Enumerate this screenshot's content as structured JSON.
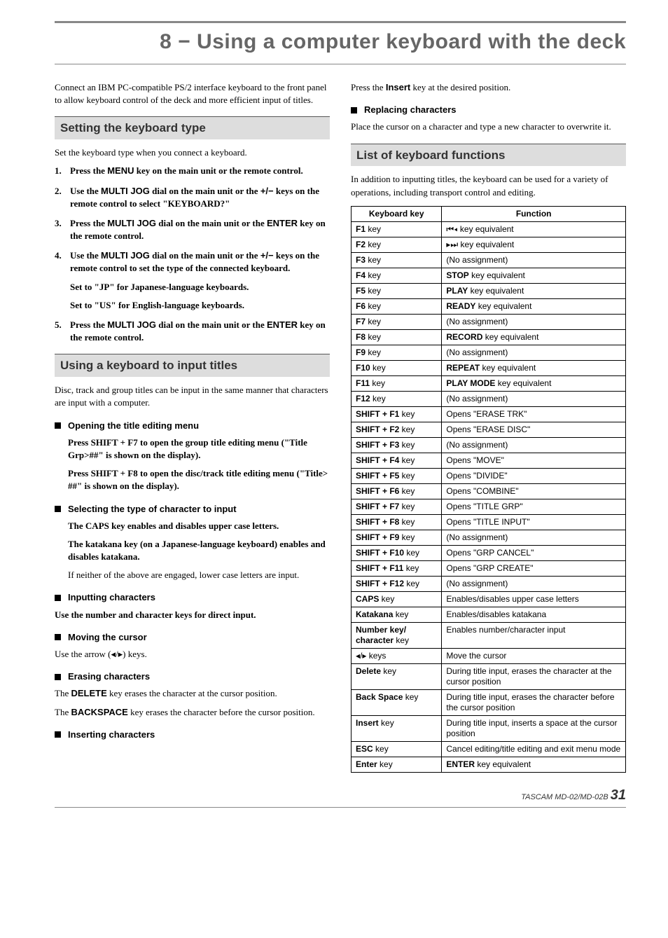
{
  "chapter": {
    "title": "8 − Using a computer keyboard with the deck"
  },
  "intro_left": "Connect an IBM PC-compatible PS/2 interface keyboard to the front panel to allow keyboard control of the deck and more efficient input of titles.",
  "section_setting": {
    "title": "Setting the keyboard type",
    "intro": "Set the keyboard type when you connect a keyboard.",
    "steps": [
      {
        "num": "1.",
        "text_parts": [
          "Press the ",
          "MENU",
          " key on the main unit or the remote control."
        ]
      },
      {
        "num": "2.",
        "text_parts": [
          "Use the ",
          "MULTI JOG",
          " dial on the main unit or the ",
          "+/−",
          " keys on the remote control to select \"KEYBOARD?\""
        ]
      },
      {
        "num": "3.",
        "text_parts": [
          "Press the ",
          "MULTI JOG",
          " dial on the main unit or the ",
          "ENTER",
          " key on the remote control."
        ]
      },
      {
        "num": "4.",
        "text_parts": [
          "Use the ",
          "MULTI JOG",
          " dial on the main unit or the ",
          "+/−",
          " keys on the remote control to set the type of the connected keyboard."
        ],
        "sub": [
          "Set to \"JP\" for Japanese-language keyboards.",
          "Set to \"US\" for English-language keyboards."
        ]
      },
      {
        "num": "5.",
        "text_parts": [
          "Press  the ",
          "MULTI JOG",
          " dial on the main unit or the ",
          "ENTER",
          " key on the remote control."
        ]
      }
    ]
  },
  "section_using": {
    "title": "Using a keyboard to input titles",
    "intro": "Disc, track and group titles can be input in the same manner that characters are input with a computer.",
    "opening": {
      "title": "Opening the title editing menu",
      "p1": "Press SHIFT + F7 to open the group title editing menu (\"Title Grp>##\" is shown on the display).",
      "p2": "Press SHIFT + F8 to open the disc/track title editing menu (\"Title> ##\" is shown on the display)."
    },
    "selecting": {
      "title": "Selecting the type of character to input",
      "p1": "The CAPS key enables and disables upper case letters.",
      "p2": "The katakana key (on a Japanese-language keyboard) enables and disables katakana.",
      "p3": "If neither of the above are engaged, lower case letters are input."
    },
    "inputting": {
      "title": "Inputting characters",
      "p": "Use the number and character keys for direct input."
    },
    "moving": {
      "title": "Moving the cursor",
      "p": "Use the arrow (◂/▸) keys."
    },
    "erasing": {
      "title": "Erasing characters",
      "p1_pre": "The ",
      "p1_key": "DELETE",
      "p1_post": " key erases the character at the cursor position.",
      "p2_pre": "The ",
      "p2_key": "BACKSPACE",
      "p2_post": " key erases the character before the cursor position."
    },
    "inserting_h": "Inserting characters"
  },
  "right": {
    "press_insert_pre": "Press the ",
    "press_insert_key": "Insert",
    "press_insert_post": " key at the desired position.",
    "replacing": {
      "title": "Replacing characters",
      "p": "Place the cursor on a character and type a new character to overwrite it."
    }
  },
  "section_list": {
    "title": "List of keyboard functions",
    "intro": "In addition to inputting titles, the keyboard can be used for a variety of operations, including transport control and editing.",
    "headers": [
      "Keyboard key",
      "Function"
    ],
    "rows": [
      {
        "key": "F1",
        "suffix": " key",
        "func_html": "⏮◂ key equivalent"
      },
      {
        "key": "F2",
        "suffix": " key",
        "func_html": "▸⏭ key equivalent"
      },
      {
        "key": "F3",
        "suffix": " key",
        "func_html": "(No assignment)"
      },
      {
        "key": "F4",
        "suffix": " key",
        "func_bold": "STOP",
        "func_rest": " key equivalent"
      },
      {
        "key": "F5",
        "suffix": " key",
        "func_bold": "PLAY",
        "func_rest": " key equivalent"
      },
      {
        "key": "F6",
        "suffix": " key",
        "func_bold": "READY",
        "func_rest": " key equivalent"
      },
      {
        "key": "F7",
        "suffix": " key",
        "func_html": "(No assignment)"
      },
      {
        "key": "F8",
        "suffix": " key",
        "func_bold": "RECORD",
        "func_rest": " key equivalent"
      },
      {
        "key": "F9",
        "suffix": " key",
        "func_html": "(No assignment)"
      },
      {
        "key": "F10",
        "suffix": " key",
        "func_bold": "REPEAT",
        "func_rest": " key equivalent"
      },
      {
        "key": "F11",
        "suffix": " key",
        "func_bold": "PLAY MODE",
        "func_rest": " key equivalent"
      },
      {
        "key": "F12",
        "suffix": " key",
        "func_html": "(No assignment)"
      },
      {
        "key": "SHIFT + F1",
        "suffix": " key",
        "func_html": "Opens \"ERASE TRK\""
      },
      {
        "key": "SHIFT + F2",
        "suffix": " key",
        "func_html": "Opens \"ERASE DISC\""
      },
      {
        "key": "SHIFT + F3",
        "suffix": " key",
        "func_html": "(No assignment)"
      },
      {
        "key": "SHIFT + F4",
        "suffix": " key",
        "func_html": "Opens \"MOVE\""
      },
      {
        "key": "SHIFT + F5",
        "suffix": " key",
        "func_html": "Opens \"DIVIDE\""
      },
      {
        "key": "SHIFT + F6",
        "suffix": " key",
        "func_html": "Opens \"COMBINE\""
      },
      {
        "key": "SHIFT + F7",
        "suffix": " key",
        "func_html": "Opens \"TITLE GRP\""
      },
      {
        "key": "SHIFT + F8",
        "suffix": " key",
        "func_html": "Opens \"TITLE INPUT\""
      },
      {
        "key": "SHIFT + F9",
        "suffix": " key",
        "func_html": "(No assignment)"
      },
      {
        "key": "SHIFT + F10",
        "suffix": " key",
        "func_html": "Opens \"GRP CANCEL\""
      },
      {
        "key": "SHIFT + F11",
        "suffix": " key",
        "func_html": "Opens \"GRP CREATE\""
      },
      {
        "key": "SHIFT + F12",
        "suffix": " key",
        "func_html": "(No assignment)"
      },
      {
        "key": "CAPS",
        "suffix": " key",
        "func_html": "Enables/disables upper case letters"
      },
      {
        "key": "Katakana",
        "suffix": " key",
        "func_html": "Enables/disables katakana"
      },
      {
        "key": "Number key/\ncharacter",
        "suffix": " key",
        "func_html": "Enables number/character input"
      },
      {
        "key_plain": "◂/▸ keys",
        "func_html": "Move the cursor"
      },
      {
        "key": "Delete",
        "suffix": " key",
        "func_html": "During title input, erases the character at the cursor position"
      },
      {
        "key": "Back Space",
        "suffix": " key",
        "func_html": "During title input, erases the character before the cursor position"
      },
      {
        "key": "Insert",
        "suffix": " key",
        "func_html": "During title input, inserts a space at the cursor position"
      },
      {
        "key": "ESC",
        "suffix": " key",
        "func_html": "Cancel editing/title editing and exit menu mode"
      },
      {
        "key": "Enter",
        "suffix": " key",
        "func_bold": "ENTER",
        "func_rest": " key equivalent"
      }
    ]
  },
  "footer": {
    "product": "TASCAM  MD-02/MD-02B",
    "page": "31"
  }
}
